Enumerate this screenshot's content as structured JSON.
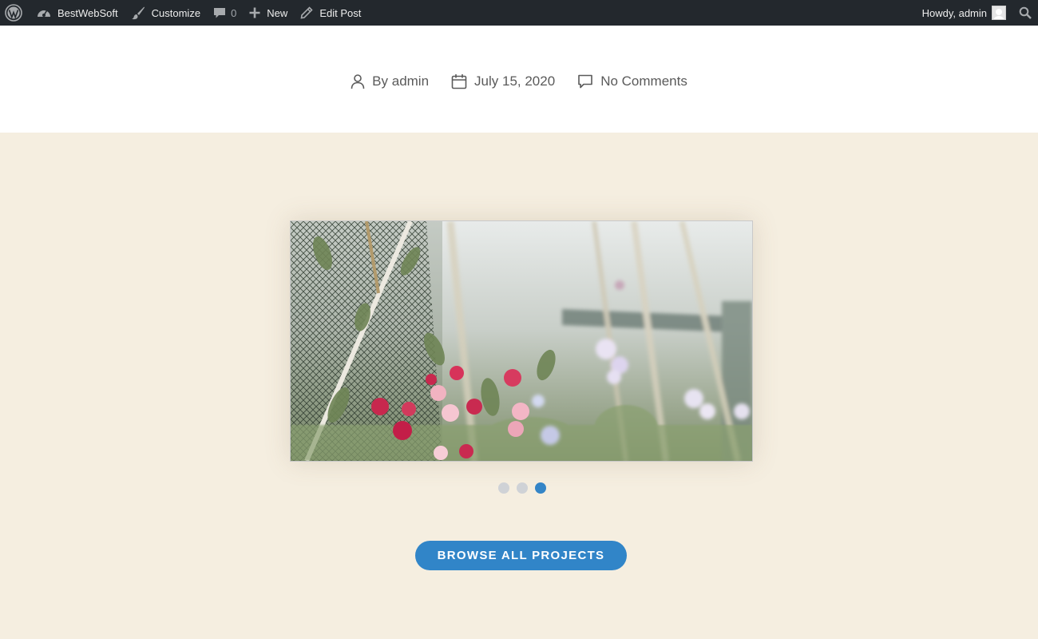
{
  "adminbar": {
    "site_name": "BestWebSoft",
    "customize": "Customize",
    "comments_count": "0",
    "new": "New",
    "edit_post": "Edit Post",
    "howdy": "Howdy, admin",
    "icons": [
      "wordpress-logo-icon",
      "dashboard-icon",
      "brush-icon",
      "comment-bubble-icon",
      "plus-icon",
      "pencil-icon",
      "search-icon"
    ]
  },
  "post_meta": {
    "author": "By admin",
    "date": "July 15, 2020",
    "comments": "No Comments"
  },
  "slider": {
    "image_alt": "Sweet pea flowers growing on netting",
    "dots": [
      {
        "active": false
      },
      {
        "active": false
      },
      {
        "active": true
      }
    ]
  },
  "projects": {
    "button_label": "BROWSE ALL PROJECTS"
  },
  "colors": {
    "adminbar_bg": "#23282d",
    "section_bg": "#f5eee0",
    "accent": "#3185c8",
    "dot_inactive": "#cfd2d6"
  }
}
